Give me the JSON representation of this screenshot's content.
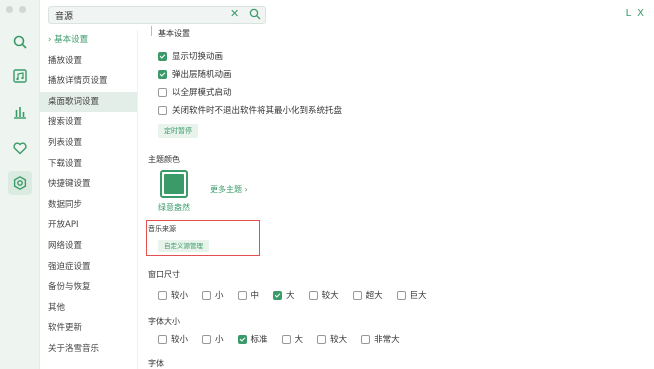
{
  "window": {
    "min_label": "L",
    "close_label": "X"
  },
  "rail": {
    "icons": [
      "search-icon",
      "music-icon",
      "chart-icon",
      "heart-icon",
      "settings-icon"
    ],
    "accent": "#3a9b68"
  },
  "search": {
    "value": "音源",
    "clear_glyph": "✕"
  },
  "nav": {
    "items": [
      {
        "label": "基本设置",
        "prefix": "› "
      },
      {
        "label": "播放设置"
      },
      {
        "label": "播放详情页设置"
      },
      {
        "label": "桌面歌词设置"
      },
      {
        "label": "搜索设置"
      },
      {
        "label": "列表设置"
      },
      {
        "label": "下载设置"
      },
      {
        "label": "快捷键设置"
      },
      {
        "label": "数据同步"
      },
      {
        "label": "开放API"
      },
      {
        "label": "网络设置"
      },
      {
        "label": "强迫症设置"
      },
      {
        "label": "备份与恢复"
      },
      {
        "label": "其他"
      },
      {
        "label": "软件更新"
      },
      {
        "label": "关于洛雪音乐"
      }
    ]
  },
  "basic": {
    "title": "基本设置",
    "checks": [
      {
        "label": "显示切换动画",
        "checked": true
      },
      {
        "label": "弹出层随机动画",
        "checked": true
      },
      {
        "label": "以全屏模式启动",
        "checked": false
      },
      {
        "label": "关闭软件时不退出软件将其最小化到系统托盘",
        "checked": false
      }
    ],
    "timer_button": "定时暂停"
  },
  "theme": {
    "title": "主题颜色",
    "name": "绿意盎然",
    "color": "#3a9b68",
    "more": "更多主题 ›"
  },
  "source": {
    "title": "音乐来源",
    "button": "自定义源管理"
  },
  "window_size": {
    "title": "窗口尺寸",
    "options": [
      {
        "label": "较小",
        "checked": false
      },
      {
        "label": "小",
        "checked": false
      },
      {
        "label": "中",
        "checked": false
      },
      {
        "label": "大",
        "checked": true
      },
      {
        "label": "较大",
        "checked": false
      },
      {
        "label": "超大",
        "checked": false
      },
      {
        "label": "巨大",
        "checked": false
      }
    ]
  },
  "font_size": {
    "title": "字体大小",
    "options": [
      {
        "label": "较小",
        "checked": false
      },
      {
        "label": "小",
        "checked": false
      },
      {
        "label": "标准",
        "checked": true
      },
      {
        "label": "大",
        "checked": false
      },
      {
        "label": "较大",
        "checked": false
      },
      {
        "label": "非常大",
        "checked": false
      }
    ]
  },
  "font": {
    "title": "字体"
  }
}
